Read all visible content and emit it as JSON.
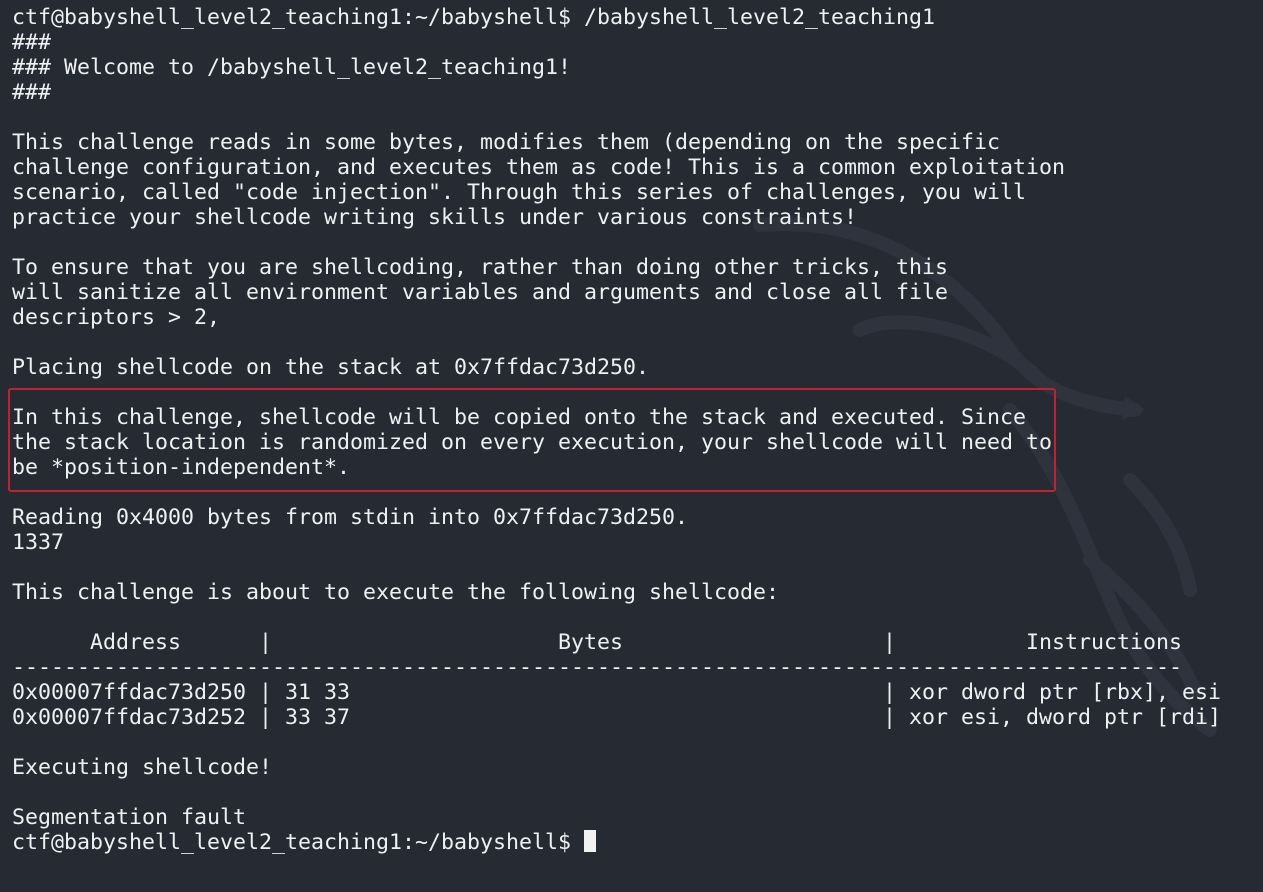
{
  "terminal": {
    "lines": [
      "ctf@babyshell_level2_teaching1:~/babyshell$ /babyshell_level2_teaching1",
      "###",
      "### Welcome to /babyshell_level2_teaching1!",
      "###",
      "",
      "This challenge reads in some bytes, modifies them (depending on the specific",
      "challenge configuration, and executes them as code! This is a common exploitation",
      "scenario, called \"code injection\". Through this series of challenges, you will",
      "practice your shellcode writing skills under various constraints!",
      "",
      "To ensure that you are shellcoding, rather than doing other tricks, this",
      "will sanitize all environment variables and arguments and close all file",
      "descriptors > 2,",
      "",
      "Placing shellcode on the stack at 0x7ffdac73d250.",
      "",
      "In this challenge, shellcode will be copied onto the stack and executed. Since",
      "the stack location is randomized on every execution, your shellcode will need to",
      "be *position-independent*.",
      "",
      "Reading 0x4000 bytes from stdin into 0x7ffdac73d250.",
      "1337",
      "",
      "This challenge is about to execute the following shellcode:",
      "",
      "      Address      |                      Bytes                    |          Instructions",
      "------------------------------------------------------------------------------------------",
      "0x00007ffdac73d250 | 31 33                                         | xor dword ptr [rbx], esi",
      "0x00007ffdac73d252 | 33 37                                         | xor esi, dword ptr [rdi]",
      "",
      "Executing shellcode!",
      "",
      "Segmentation fault"
    ],
    "prompt": "ctf@babyshell_level2_teaching1:~/babyshell$ ",
    "bg_color": "#262a33",
    "text_color": "#eef0f2",
    "highlight_color": "#c0232f"
  }
}
